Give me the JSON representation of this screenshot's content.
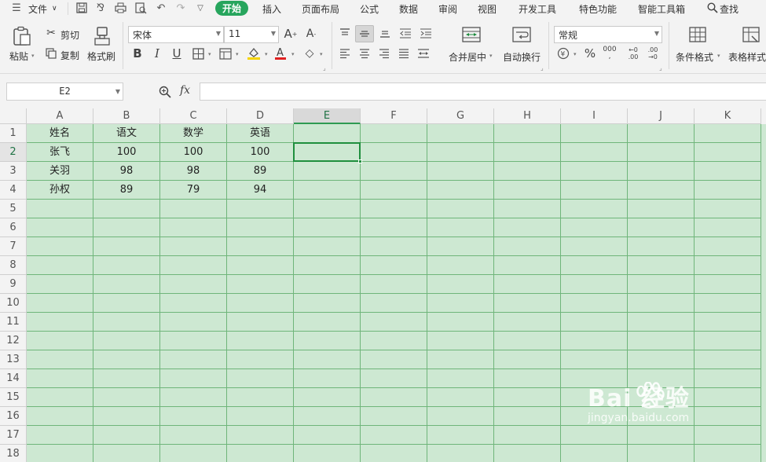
{
  "menu": {
    "file_label": "文件",
    "tabs": [
      "开始",
      "插入",
      "页面布局",
      "公式",
      "数据",
      "审阅",
      "视图",
      "开发工具",
      "特色功能",
      "智能工具箱"
    ],
    "search_label": "查找"
  },
  "ribbon": {
    "paste_label": "粘贴",
    "cut_label": "剪切",
    "copy_label": "复制",
    "format_painter_label": "格式刷",
    "font_name": "宋体",
    "font_size": "11",
    "merge_center_label": "合并居中",
    "wrap_text_label": "自动换行",
    "number_format": "常规",
    "conditional_format_label": "条件格式",
    "table_style_label": "表格样式"
  },
  "formula_bar": {
    "name_box": "E2",
    "fx_label": "fx",
    "formula": ""
  },
  "sheet": {
    "columns": [
      "A",
      "B",
      "C",
      "D",
      "E",
      "F",
      "G",
      "H",
      "I",
      "J",
      "K"
    ],
    "rows": [
      "1",
      "2",
      "3",
      "4",
      "5",
      "6",
      "7",
      "8",
      "9",
      "10",
      "11",
      "12",
      "13",
      "14",
      "15",
      "16",
      "17",
      "18"
    ],
    "data": [
      [
        "姓名",
        "语文",
        "数学",
        "英语"
      ],
      [
        "张飞",
        "100",
        "100",
        "100"
      ],
      [
        "关羽",
        "98",
        "98",
        "89"
      ],
      [
        "孙权",
        "89",
        "79",
        "94"
      ]
    ],
    "selected_cell": "E2"
  },
  "watermark": {
    "brand": "Bai  经验",
    "url": "jingyan.baidu.com"
  },
  "colors": {
    "accent": "#27a55d",
    "cell_fill": "#cde8d2",
    "grid_line": "#6fb57a"
  }
}
